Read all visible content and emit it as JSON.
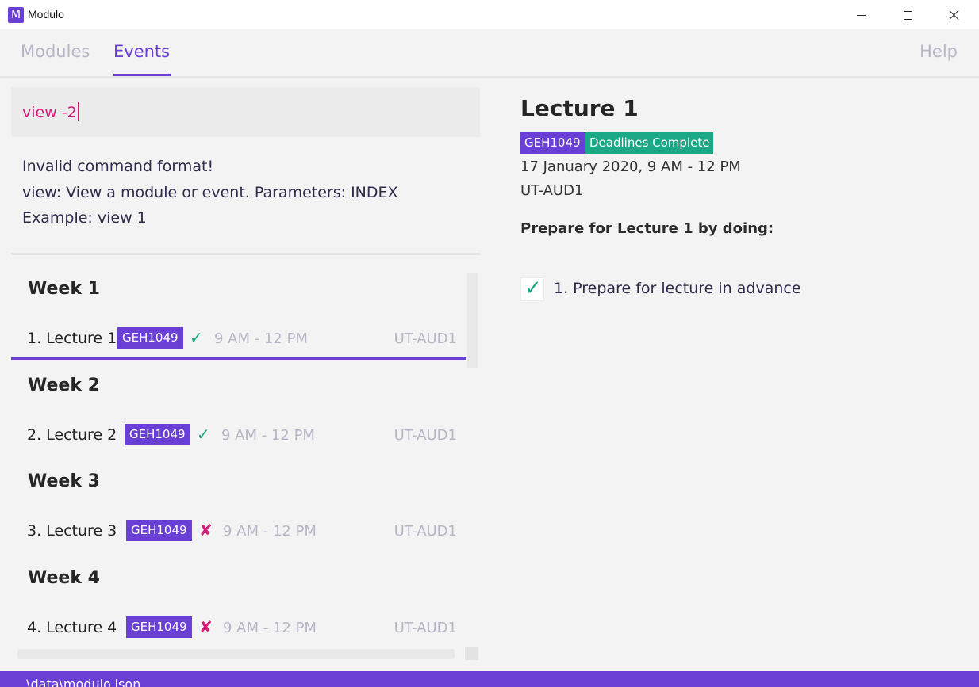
{
  "window": {
    "logo_letter": "M",
    "title": "Modulo"
  },
  "tabs": {
    "modules": "Modules",
    "events": "Events",
    "help": "Help"
  },
  "command": {
    "value": "view -2"
  },
  "result": {
    "line1": "Invalid command format!",
    "line2": "view: View a module or event. Parameters: INDEX",
    "line3": "Example: view 1"
  },
  "weeks": [
    "Week 1",
    "Week 2",
    "Week 3",
    "Week 4"
  ],
  "events": [
    {
      "title": "1. Lecture 1",
      "module": "GEH1049",
      "status": "✓",
      "time": "9 AM - 12 PM",
      "location": "UT-AUD1"
    },
    {
      "title": "2. Lecture 2",
      "module": "GEH1049",
      "status": "✓",
      "time": "9 AM - 12 PM",
      "location": "UT-AUD1"
    },
    {
      "title": "3. Lecture 3",
      "module": "GEH1049",
      "status": "✘",
      "time": "9 AM - 12 PM",
      "location": "UT-AUD1"
    },
    {
      "title": "4. Lecture 4",
      "module": "GEH1049",
      "status": "✘",
      "time": "9 AM - 12 PM",
      "location": "UT-AUD1"
    }
  ],
  "detail": {
    "title": "Lecture 1",
    "module_tag": "GEH1049",
    "status_tag": "Deadlines Complete",
    "datetime": "17 January 2020, 9 AM - 12 PM",
    "location": "UT-AUD1",
    "prepare_label": "Prepare for Lecture 1 by doing:",
    "deadline_check": "✓",
    "deadline": "1. Prepare for lecture in advance"
  },
  "statusbar": {
    "path": ".\\data\\modulo.json"
  },
  "colors": {
    "accent": "#6a3fd6",
    "complete": "#1ba886",
    "error": "#d81b7a"
  }
}
